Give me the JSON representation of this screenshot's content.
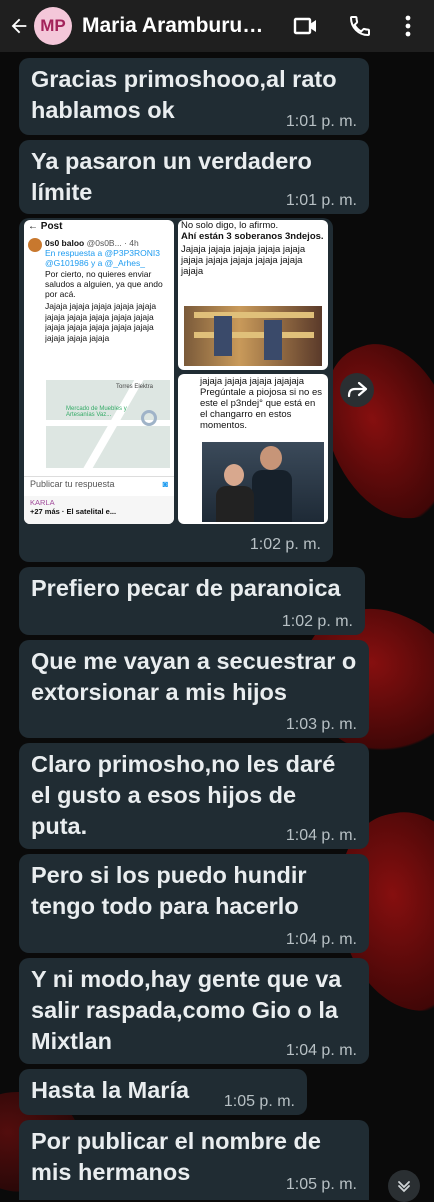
{
  "header": {
    "avatar_initials": "MP",
    "title": "Maria Aramburu…"
  },
  "messages": [
    {
      "text": "Gracias  primoshooo,al rato hablamos ok",
      "time": "1:01 p. m."
    },
    {
      "text": "Ya pasaron un verdadero límite",
      "time": "1:01 p. m."
    },
    {
      "text": "Prefiero pecar de paranoica",
      "time": "1:02 p. m."
    },
    {
      "text": "Que me vayan a secuestrar o extorsionar a mis hijos",
      "time": "1:03 p. m."
    },
    {
      "text": "Claro primosho,no les daré el gusto a esos hijos de puta.",
      "time": "1:04 p. m."
    },
    {
      "text": "Pero si los puedo hundir tengo todo para hacerlo",
      "time": "1:04 p. m."
    },
    {
      "text": "Y ni modo,hay gente que va salir raspada,como Gio o la Mixtlan",
      "time": "1:04 p. m."
    },
    {
      "text": "Hasta la María",
      "time": "1:05 p. m."
    },
    {
      "text": "Por publicar el nombre de mis hermanos",
      "time": "1:05 p. m."
    }
  ],
  "media": {
    "time": "1:02 p. m.",
    "post": {
      "header": "Post",
      "author": "0s0 baloo",
      "handle": "@0s0B...",
      "age": "· 4h",
      "reply_to": "En respuesta a @P3P3RONI3 @G101986 y a @_Arhes_",
      "body": "Por cierto, no quieres enviar saludos a alguien, ya que ando por acá.",
      "laughs": "Jajaja jajaja jajaja jajaja jajaja jajaja jajaja jajaja jajaja jajaja jajaja jajaja jajaja jajaja jajaja jajaja jajaja jajaja",
      "map_labels": [
        "Torres Elektra",
        "Mercado de Muebles y Artesanías Vaz..."
      ],
      "reply_placeholder": "Publicar tu respuesta",
      "footer_name": "KARLA",
      "footer_text": "+27 más · El satelital e..."
    },
    "thumb2": {
      "top": "No solo digo, lo afirmo.",
      "line2": "Ahí están 3 soberanos 3ndejos.",
      "laughs": "Jajaja jajaja jajaja jajaja jajaja jajaja jajaja jajaja jajaja jajaja jajaja"
    },
    "thumb3": {
      "text": "jajaja jajaja jajaja jajajaja Pregúntale a piojosa si no es este el p3ndej° que está en el changarro en estos momentos."
    }
  }
}
